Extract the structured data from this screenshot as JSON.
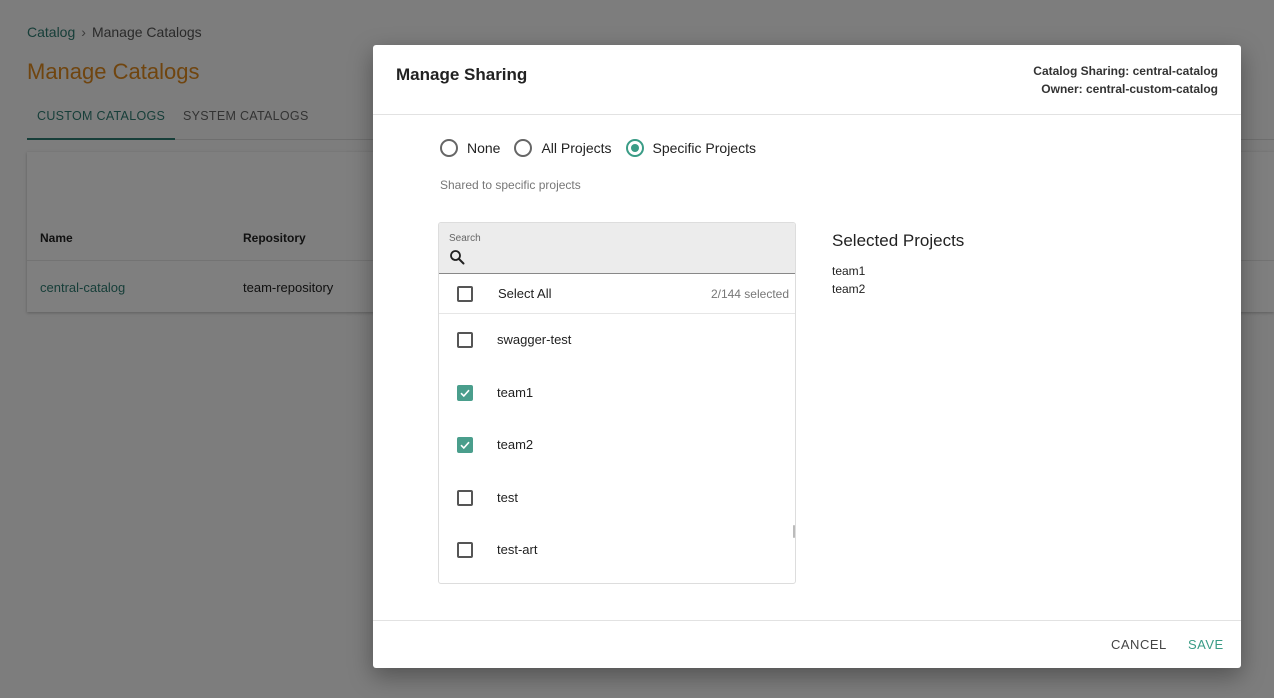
{
  "breadcrumb": {
    "root": "Catalog",
    "separator": "›",
    "current": "Manage Catalogs"
  },
  "page": {
    "title": "Manage Catalogs"
  },
  "tabs": [
    {
      "label": "CUSTOM CATALOGS",
      "active": true
    },
    {
      "label": "SYSTEM CATALOGS",
      "active": false
    }
  ],
  "table": {
    "headers": {
      "name": "Name",
      "repository": "Repository"
    },
    "rows": [
      {
        "name": "central-catalog",
        "repository": "team-repository"
      }
    ]
  },
  "dialog": {
    "title": "Manage Sharing",
    "meta_sharing": "Catalog Sharing: central-catalog",
    "meta_owner": "Owner: central-custom-catalog",
    "radios": [
      {
        "label": "None",
        "checked": false
      },
      {
        "label": "All Projects",
        "checked": false
      },
      {
        "label": "Specific Projects",
        "checked": true
      }
    ],
    "hint": "Shared to specific projects",
    "search": {
      "label": "Search",
      "value": ""
    },
    "select_all": {
      "label": "Select All",
      "count": "2/144 selected"
    },
    "items": [
      {
        "label": "swagger-test",
        "checked": false
      },
      {
        "label": "team1",
        "checked": true
      },
      {
        "label": "team2",
        "checked": true
      },
      {
        "label": "test",
        "checked": false
      },
      {
        "label": "test-art",
        "checked": false
      }
    ],
    "selected_title": "Selected Projects",
    "selected": [
      "team1",
      "team2"
    ],
    "cancel_label": "CANCEL",
    "save_label": "SAVE"
  },
  "colors": {
    "accent": "#3a9c86",
    "title_orange": "#e08a1e",
    "link_green": "#2e7d72"
  },
  "icons": {
    "search": "search-icon",
    "check": "check-icon"
  }
}
